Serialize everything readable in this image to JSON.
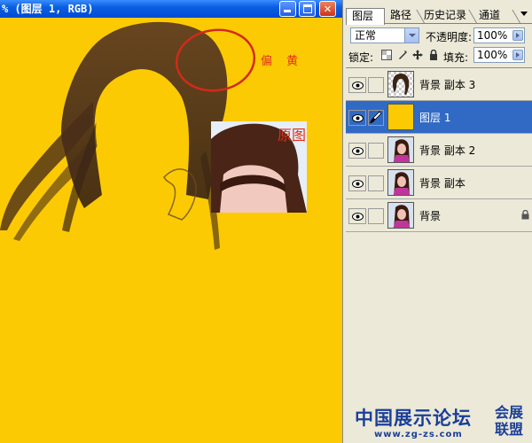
{
  "window": {
    "title": "% (图层 1, RGB)",
    "minimize_icon": "minimize-icon",
    "maximize_icon": "maximize-icon",
    "close_icon": "close-icon"
  },
  "canvas": {
    "fill_color": "#fcca03",
    "annotation_yellowish": "偏 黄",
    "annotation_original": "原图",
    "circle_color": "#d22a1a"
  },
  "palette": {
    "tabs": [
      "图层",
      "路径",
      "历史记录",
      "通道"
    ],
    "blend_mode": "正常",
    "opacity_label": "不透明度:",
    "opacity_value": "100%",
    "lock_label": "锁定:",
    "fill_label": "填充:",
    "fill_value": "100%",
    "layers": [
      {
        "name": "背景 副本 3",
        "visible": true,
        "selected": false,
        "thumb": "hair-on-transparent"
      },
      {
        "name": "图层 1",
        "visible": true,
        "selected": true,
        "thumb": "solid-yellow",
        "brush_icon": "brush-icon"
      },
      {
        "name": "背景 副本 2",
        "visible": true,
        "selected": false,
        "thumb": "photo"
      },
      {
        "name": "背景 副本",
        "visible": true,
        "selected": false,
        "thumb": "photo"
      },
      {
        "name": "背景",
        "visible": true,
        "selected": false,
        "thumb": "photo",
        "locked": true
      }
    ]
  },
  "watermark": {
    "main": "中国展示论坛",
    "url": "www.zg-zs.com",
    "side": "会展联盟"
  }
}
